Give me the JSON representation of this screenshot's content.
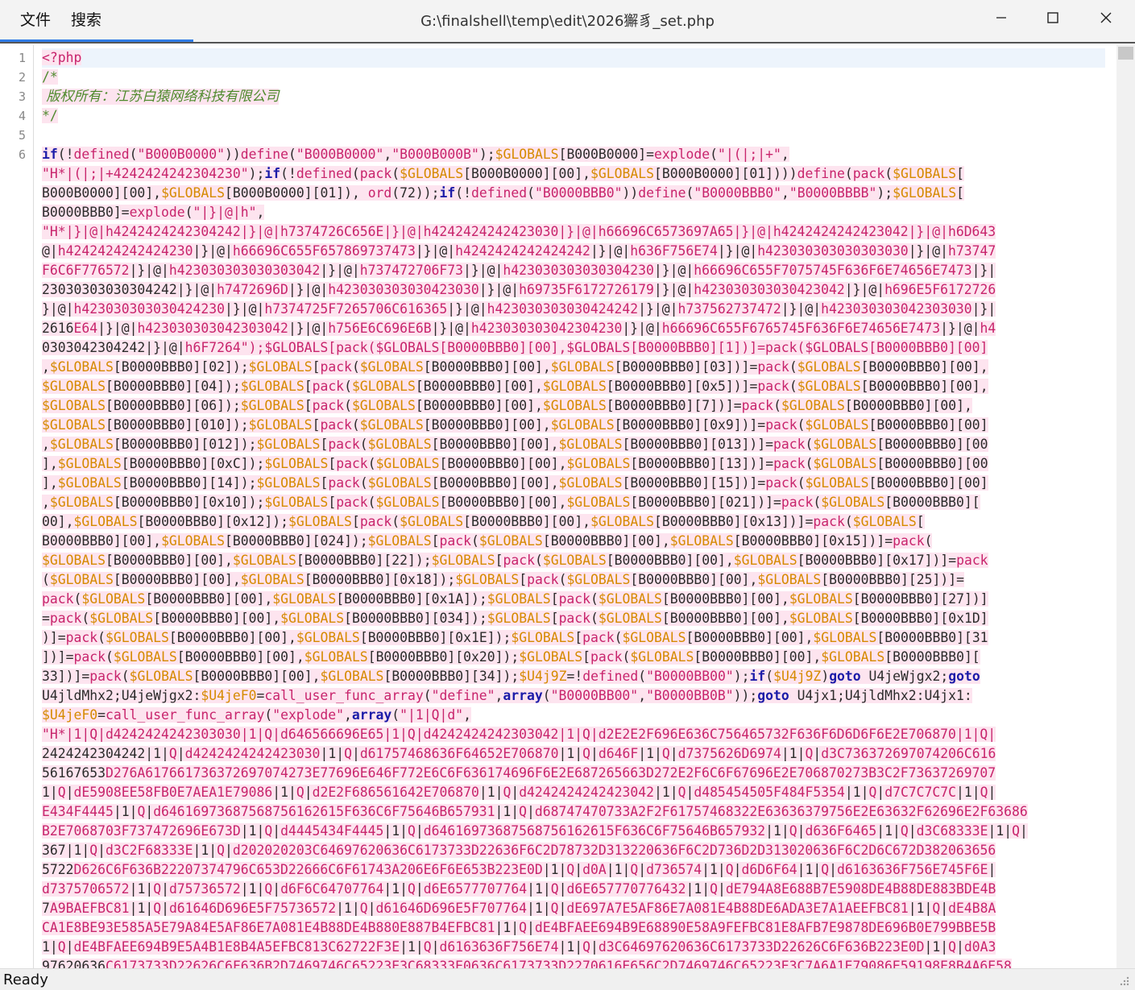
{
  "menu": {
    "file": "文件",
    "search": "搜索"
  },
  "window": {
    "title": "G:\\finalshell\\temp\\edit\\2026獬豸_set.php"
  },
  "line_numbers": [
    "1",
    "2",
    "3",
    "4",
    "5",
    "6"
  ],
  "code": {
    "l1": "<?php",
    "l2": "/*",
    "l3": " 版权所有：江苏白猿网络科技有限公司",
    "l4": "*/",
    "l5": "",
    "wrapped": [
      "if(!defined(\"B000B0000\"))define(\"B000B0000\",\"B000B000B\");$GLOBALS[B000B0000]=explode(\"|(|;|+\",",
      "\"H*|(|;|+4242424242304230\");if(!defined(pack($GLOBALS[B000B0000][00],$GLOBALS[B000B0000][01])))define(pack($GLOBALS[",
      "B000B0000][00],$GLOBALS[B000B0000][01]), ord(72));if(!defined(\"B0000BBB0\"))define(\"B0000BBB0\",\"B0000BBBB\");$GLOBALS[",
      "B0000BBB0]=explode(\"|}|@|h\",",
      "\"H*|}|@|h4242424242304242|}|@|h7374726C656E|}|@|h4242424242423030|}|@|h66696C6573697A65|}|@|h4242424242423042|}|@|h6D643",
      "@|h4242424242424230|}|@|h66696C655F657869737473|}|@|h4242424242424242|}|@|h636F756E74|}|@|h423030303030303030|}|@|h73747",
      "F6C6F776572|}|@|h423030303030303042|}|@|h737472706F73|}|@|h423030303030304230|}|@|h66696C655F7075745F636F6E74656E7473|}|",
      "23030303030304242|}|@|h7472696D|}|@|h423030303030423030|}|@|h69735F6172726179|}|@|h423030303030423042|}|@|h696E5F6172726",
      "}|@|h423030303030424230|}|@|h7374725F7265706C616365|}|@|h423030303030424242|}|@|h737562737472|}|@|h423030303042303030|}|",
      "2616E64|}|@|h423030303042303042|}|@|h756E6C696E6B|}|@|h423030303042304230|}|@|h66696C655F6765745F636F6E74656E7473|}|@|h4",
      "0303042304242|}|@|h6F7264\");$GLOBALS[pack($GLOBALS[B0000BBB0][00],$GLOBALS[B0000BBB0][1])]=pack($GLOBALS[B0000BBB0][00]",
      ",$GLOBALS[B0000BBB0][02]);$GLOBALS[pack($GLOBALS[B0000BBB0][00],$GLOBALS[B0000BBB0][03])]=pack($GLOBALS[B0000BBB0][00],",
      "$GLOBALS[B0000BBB0][04]);$GLOBALS[pack($GLOBALS[B0000BBB0][00],$GLOBALS[B0000BBB0][0x5])]=pack($GLOBALS[B0000BBB0][00],",
      "$GLOBALS[B0000BBB0][06]);$GLOBALS[pack($GLOBALS[B0000BBB0][00],$GLOBALS[B0000BBB0][7])]=pack($GLOBALS[B0000BBB0][00],",
      "$GLOBALS[B0000BBB0][010]);$GLOBALS[pack($GLOBALS[B0000BBB0][00],$GLOBALS[B0000BBB0][0x9])]=pack($GLOBALS[B0000BBB0][00]",
      ",$GLOBALS[B0000BBB0][012]);$GLOBALS[pack($GLOBALS[B0000BBB0][00],$GLOBALS[B0000BBB0][013])]=pack($GLOBALS[B0000BBB0][00",
      "],$GLOBALS[B0000BBB0][0xC]);$GLOBALS[pack($GLOBALS[B0000BBB0][00],$GLOBALS[B0000BBB0][13])]=pack($GLOBALS[B0000BBB0][00",
      "],$GLOBALS[B0000BBB0][14]);$GLOBALS[pack($GLOBALS[B0000BBB0][00],$GLOBALS[B0000BBB0][15])]=pack($GLOBALS[B0000BBB0][00]",
      ",$GLOBALS[B0000BBB0][0x10]);$GLOBALS[pack($GLOBALS[B0000BBB0][00],$GLOBALS[B0000BBB0][021])]=pack($GLOBALS[B0000BBB0][",
      "00],$GLOBALS[B0000BBB0][0x12]);$GLOBALS[pack($GLOBALS[B0000BBB0][00],$GLOBALS[B0000BBB0][0x13])]=pack($GLOBALS[",
      "B0000BBB0][00],$GLOBALS[B0000BBB0][024]);$GLOBALS[pack($GLOBALS[B0000BBB0][00],$GLOBALS[B0000BBB0][0x15])]=pack(",
      "$GLOBALS[B0000BBB0][00],$GLOBALS[B0000BBB0][22]);$GLOBALS[pack($GLOBALS[B0000BBB0][00],$GLOBALS[B0000BBB0][0x17])]=pack",
      "($GLOBALS[B0000BBB0][00],$GLOBALS[B0000BBB0][0x18]);$GLOBALS[pack($GLOBALS[B0000BBB0][00],$GLOBALS[B0000BBB0][25])]=",
      "pack($GLOBALS[B0000BBB0][00],$GLOBALS[B0000BBB0][0x1A]);$GLOBALS[pack($GLOBALS[B0000BBB0][00],$GLOBALS[B0000BBB0][27])]",
      "=pack($GLOBALS[B0000BBB0][00],$GLOBALS[B0000BBB0][034]);$GLOBALS[pack($GLOBALS[B0000BBB0][00],$GLOBALS[B0000BBB0][0x1D]",
      ")]=pack($GLOBALS[B0000BBB0][00],$GLOBALS[B0000BBB0][0x1E]);$GLOBALS[pack($GLOBALS[B0000BBB0][00],$GLOBALS[B0000BBB0][31",
      "])]=pack($GLOBALS[B0000BBB0][00],$GLOBALS[B0000BBB0][0x20]);$GLOBALS[pack($GLOBALS[B0000BBB0][00],$GLOBALS[B0000BBB0][",
      "33])]=pack($GLOBALS[B0000BBB0][00],$GLOBALS[B0000BBB0][34]);$U4j9Z=!defined(\"B0000BB00\");if($U4j9Z)goto U4jeWjgx2;goto",
      "U4jldMhx2;U4jeWjgx2:$U4jeF0=call_user_func_array(\"define\",array(\"B0000BB00\",\"B0000BB0B\"));goto U4jx1;U4jldMhx2:U4jx1:",
      "$U4jeF0=call_user_func_array(\"explode\",array(\"|1|Q|d\",",
      "\"H*|1|Q|d4242424242303030|1|Q|d646566696E65|1|Q|d4242424242303042|1|Q|d2E2E2F696E636C756465732F636F6D6D6F6E2E706870|1|Q|",
      "2424242304242|1|Q|d4242424242423030|1|Q|d61757468636F64652E706870|1|Q|d646F|1|Q|d7375626D6974|1|Q|d3C736372697074206C616",
      "56167653D276A617661736372697074273E77696E646F772E6C6F636174696F6E2E687265663D272E2F6C6F67696E2E706870273B3C2F73637269707",
      "1|Q|dE5908EE58FB0E7AEA1E79086|1|Q|d2E2F686561642E706870|1|Q|d4242424242423042|1|Q|d485454505F484F5354|1|Q|d7C7C7C7C|1|Q|",
      "E434F4445|1|Q|d64616973687568756162615F636C6F75646B657931|1|Q|d68747470733A2F2F61757468322E63636379756E2E63632F62696E2F63686",
      "B2E7068703F737472696E673D|1|Q|d4445434F4445|1|Q|d64616973687568756162615F636C6F75646B657932|1|Q|d636F6465|1|Q|d3C68333E|1|Q|",
      "367|1|Q|d3C2F68333E|1|Q|d202020203C64697620636C6173733D22636F6C2D78732D313220636F6C2D736D2D313020636F6C2D6C672D382063656",
      "5722D626C6F636B22207374796C653D22666C6F61743A206E6F6E653B223E0D|1|Q|d0A|1|Q|d736574|1|Q|d6D6F64|1|Q|d6163636F756E745F6E|",
      "d7375706572|1|Q|d75736572|1|Q|d6F6C64707764|1|Q|d6E6577707764|1|Q|d6E657770776432|1|Q|dE794A8E688B7E5908DE4B88DE883BDE4B",
      "7A9BAEFBC81|1|Q|d61646D696E5F75736572|1|Q|d61646D696E5F707764|1|Q|dE697A7E5AF86E7A081E4B88DE6ADA3E7A1AEEFBC81|1|Q|dE4B8A",
      "CA1E8BE93E585A5E79A84E5AF86E7A081E4B88DE4B880E887B4EFBC81|1|Q|dE4BFAEE694B9E68890E58A9FEFBC81E8AFB7E9878DE696B0E799BBE5B",
      "1|Q|dE4BFAEE694B9E5A4B1E8B4A5EFBC813C62722F3E|1|Q|d6163636F756E74|1|Q|d3C64697620636C6173733D22626C6F636B223E0D|1|Q|d0A3",
      "97620636C6173733D22626C6F636B2D7469746C65223E3C68333E0636C6173733D2270616E656C2D7469746C65223E3C7A6A1E79086E59198E8B4A6E58"
    ]
  },
  "status": {
    "text": "Ready"
  },
  "colors": {
    "keyword": "#1b1ba8",
    "string": "#c8246c",
    "globals": "#d68a00",
    "comment": "#4e8a2d",
    "highlight": "#fde4ef",
    "accent": "#2f7be5"
  }
}
